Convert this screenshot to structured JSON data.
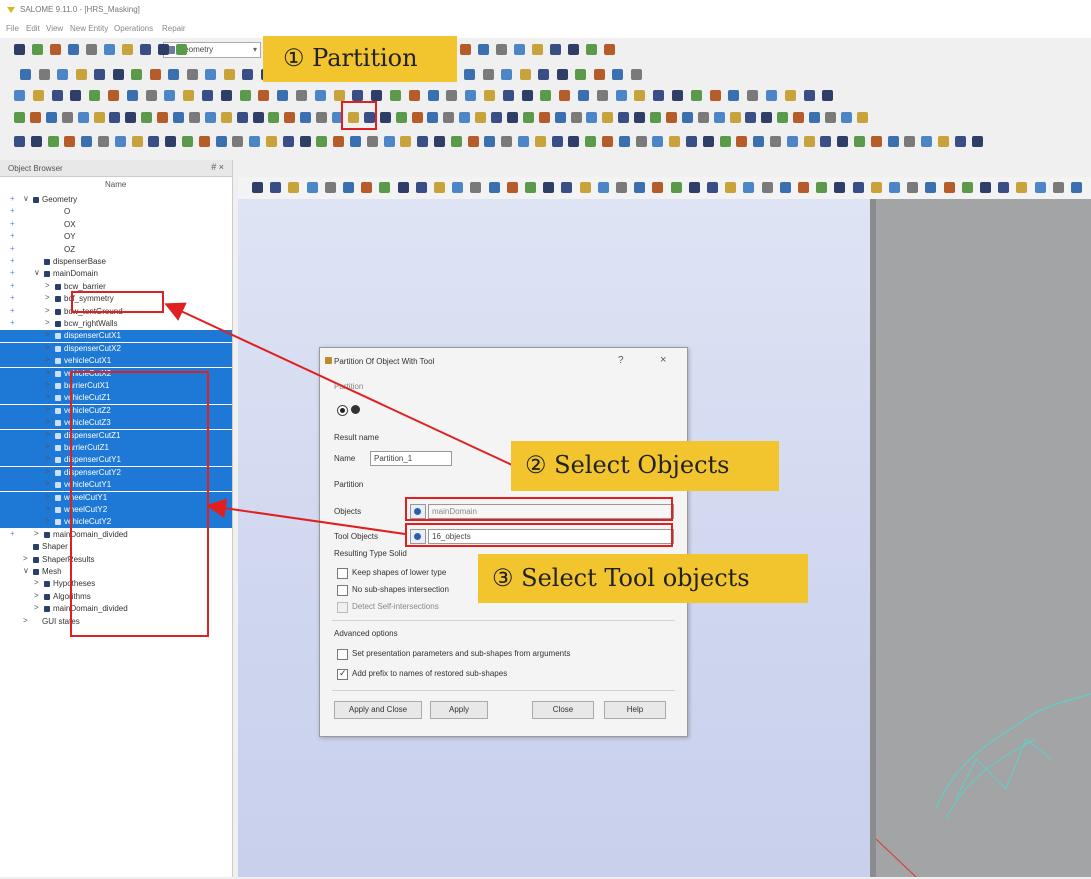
{
  "window": {
    "title": "SALOME 9.11.0 - [HRS_Masking]"
  },
  "menu": [
    "File",
    "Edit",
    "View",
    "New Entity",
    "Operations",
    "Repair"
  ],
  "module_combo": "Geometry",
  "object_browser": {
    "title": "Object Browser",
    "header_buttons": "# ×",
    "column_name": "Name",
    "rows": [
      {
        "label": "Geometry",
        "indent": 1,
        "arrow": "∨",
        "icon": true,
        "plus": true
      },
      {
        "label": "O",
        "indent": 3,
        "arrow": "",
        "icon": false,
        "plus": true
      },
      {
        "label": "OX",
        "indent": 3,
        "arrow": "",
        "icon": false,
        "plus": true
      },
      {
        "label": "OY",
        "indent": 3,
        "arrow": "",
        "icon": false,
        "plus": true
      },
      {
        "label": "OZ",
        "indent": 3,
        "arrow": "",
        "icon": false,
        "plus": true
      },
      {
        "label": "dispenserBase",
        "indent": 2,
        "arrow": "",
        "icon": true,
        "plus": true
      },
      {
        "label": "mainDomain",
        "indent": 2,
        "arrow": "∨",
        "icon": true,
        "plus": true
      },
      {
        "label": "bcw_barrier",
        "indent": 3,
        "arrow": ">",
        "icon": true,
        "plus": true
      },
      {
        "label": "bcf_symmetry",
        "indent": 3,
        "arrow": ">",
        "icon": true,
        "plus": true
      },
      {
        "label": "bcw_tentGround",
        "indent": 3,
        "arrow": ">",
        "icon": true,
        "plus": true
      },
      {
        "label": "bcw_rightWalls",
        "indent": 3,
        "arrow": ">",
        "icon": true,
        "plus": true
      },
      {
        "label": "dispenserCutX1",
        "indent": 3,
        "arrow": ">",
        "icon": true,
        "plus": false,
        "sel": true
      },
      {
        "label": "dispenserCutX2",
        "indent": 3,
        "arrow": ">",
        "icon": true,
        "plus": false,
        "sel": true
      },
      {
        "label": "vehicleCutX1",
        "indent": 3,
        "arrow": ">",
        "icon": true,
        "plus": false,
        "sel": true
      },
      {
        "label": "vehicleCutX2",
        "indent": 3,
        "arrow": ">",
        "icon": true,
        "plus": false,
        "sel": true
      },
      {
        "label": "barrierCutX1",
        "indent": 3,
        "arrow": ">",
        "icon": true,
        "plus": false,
        "sel": true
      },
      {
        "label": "vehicleCutZ1",
        "indent": 3,
        "arrow": ">",
        "icon": true,
        "plus": false,
        "sel": true
      },
      {
        "label": "vehicleCutZ2",
        "indent": 3,
        "arrow": ">",
        "icon": true,
        "plus": false,
        "sel": true
      },
      {
        "label": "vehicleCutZ3",
        "indent": 3,
        "arrow": ">",
        "icon": true,
        "plus": false,
        "sel": true
      },
      {
        "label": "dispenserCutZ1",
        "indent": 3,
        "arrow": ">",
        "icon": true,
        "plus": false,
        "sel": true
      },
      {
        "label": "barrierCutZ1",
        "indent": 3,
        "arrow": ">",
        "icon": true,
        "plus": false,
        "sel": true
      },
      {
        "label": "dispenserCutY1",
        "indent": 3,
        "arrow": ">",
        "icon": true,
        "plus": false,
        "sel": true
      },
      {
        "label": "dispenserCutY2",
        "indent": 3,
        "arrow": ">",
        "icon": true,
        "plus": false,
        "sel": true
      },
      {
        "label": "vehicleCutY1",
        "indent": 3,
        "arrow": ">",
        "icon": true,
        "plus": false,
        "sel": true
      },
      {
        "label": "wheelCutY1",
        "indent": 3,
        "arrow": ">",
        "icon": true,
        "plus": false,
        "sel": true
      },
      {
        "label": "wheelCutY2",
        "indent": 3,
        "arrow": ">",
        "icon": true,
        "plus": false,
        "sel": true
      },
      {
        "label": "vehicleCutY2",
        "indent": 3,
        "arrow": ">",
        "icon": true,
        "plus": false,
        "sel": true
      },
      {
        "label": "mainDomain_divided",
        "indent": 2,
        "arrow": ">",
        "icon": true,
        "plus": true
      },
      {
        "label": "Shaper",
        "indent": 1,
        "arrow": "",
        "icon": true,
        "plus": false
      },
      {
        "label": "ShaperResults",
        "indent": 1,
        "arrow": ">",
        "icon": true,
        "plus": false
      },
      {
        "label": "Mesh",
        "indent": 1,
        "arrow": "∨",
        "icon": true,
        "plus": false
      },
      {
        "label": "Hypotheses",
        "indent": 2,
        "arrow": ">",
        "icon": true,
        "plus": false
      },
      {
        "label": "Algorithms",
        "indent": 2,
        "arrow": ">",
        "icon": true,
        "plus": false
      },
      {
        "label": "mainDomain_divided",
        "indent": 2,
        "arrow": ">",
        "icon": true,
        "plus": false
      },
      {
        "label": "GUI states",
        "indent": 1,
        "arrow": ">",
        "icon": false,
        "plus": false
      }
    ]
  },
  "dialog": {
    "title": "Partition Of Object With Tool",
    "help_glyph": "?",
    "close_glyph": "×",
    "section_operation": "Partition",
    "section_result": "Result name",
    "name_label": "Name",
    "name_value": "Partition_1",
    "section_partition": "Partition",
    "objects_label": "Objects",
    "objects_value": "mainDomain",
    "tool_objects_label": "Tool Objects",
    "tool_objects_value": "16_objects",
    "resulting_type": "Resulting Type  Solid",
    "keep_shapes": "Keep shapes of lower type",
    "no_sub_shapes": "No sub-shapes intersection",
    "detect_self": "Detect Self-intersections",
    "advanced": "Advanced options",
    "set_presentation": "Set presentation parameters and sub-shapes from arguments",
    "add_prefix": "Add prefix to names of restored sub-shapes",
    "btn_apply_close": "Apply and Close",
    "btn_apply": "Apply",
    "btn_close": "Close",
    "btn_help": "Help"
  },
  "callouts": {
    "partition": "① Partition",
    "select_objects": "② Select Objects",
    "select_tool": "③ Select Tool objects"
  },
  "colors": {
    "selection": "#1e78d6",
    "callout": "#f2c42e",
    "annotation": "#e02020"
  }
}
